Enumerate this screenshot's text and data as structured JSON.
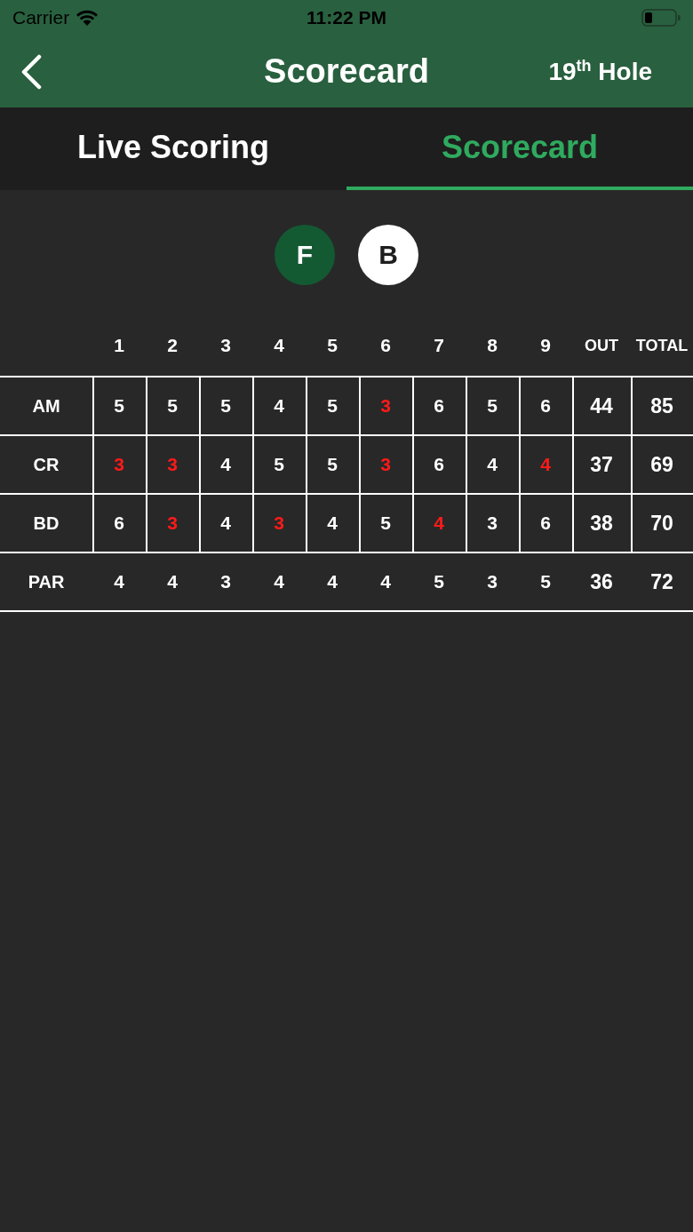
{
  "status_bar": {
    "carrier": "Carrier",
    "time": "11:22 PM"
  },
  "nav": {
    "title": "Scorecard",
    "action": "19$^{th}$ Hole"
  },
  "tabs": [
    {
      "label": "Live Scoring",
      "selected": false
    },
    {
      "label": "Scorecard",
      "selected": true
    }
  ],
  "nine_toggle": [
    {
      "label": "F",
      "selected": true
    },
    {
      "label": "B",
      "selected": false
    }
  ],
  "table": {
    "columns": [
      "1",
      "2",
      "3",
      "4",
      "5",
      "6",
      "7",
      "8",
      "9",
      "OUT",
      "TOTAL"
    ],
    "rows": [
      {
        "kind": "player",
        "name": "AM",
        "scores": [
          {
            "value": "5",
            "under_par": false
          },
          {
            "value": "5",
            "under_par": false
          },
          {
            "value": "5",
            "under_par": false
          },
          {
            "value": "4",
            "under_par": false
          },
          {
            "value": "5",
            "under_par": false
          },
          {
            "value": "3",
            "under_par": true
          },
          {
            "value": "6",
            "under_par": false
          },
          {
            "value": "5",
            "under_par": false
          },
          {
            "value": "6",
            "under_par": false
          }
        ],
        "out": "44",
        "total": "85"
      },
      {
        "kind": "player",
        "name": "CR",
        "scores": [
          {
            "value": "3",
            "under_par": true
          },
          {
            "value": "3",
            "under_par": true
          },
          {
            "value": "4",
            "under_par": false
          },
          {
            "value": "5",
            "under_par": false
          },
          {
            "value": "5",
            "under_par": false
          },
          {
            "value": "3",
            "under_par": true
          },
          {
            "value": "6",
            "under_par": false
          },
          {
            "value": "4",
            "under_par": false
          },
          {
            "value": "4",
            "under_par": true
          }
        ],
        "out": "37",
        "total": "69"
      },
      {
        "kind": "player",
        "name": "BD",
        "scores": [
          {
            "value": "6",
            "under_par": false
          },
          {
            "value": "3",
            "under_par": true
          },
          {
            "value": "4",
            "under_par": false
          },
          {
            "value": "3",
            "under_par": true
          },
          {
            "value": "4",
            "under_par": false
          },
          {
            "value": "5",
            "under_par": false
          },
          {
            "value": "4",
            "under_par": true
          },
          {
            "value": "3",
            "under_par": false
          },
          {
            "value": "6",
            "under_par": false
          }
        ],
        "out": "38",
        "total": "70"
      },
      {
        "kind": "par",
        "name": "PAR",
        "scores": [
          {
            "value": "4",
            "under_par": false
          },
          {
            "value": "4",
            "under_par": false
          },
          {
            "value": "3",
            "under_par": false
          },
          {
            "value": "4",
            "under_par": false
          },
          {
            "value": "4",
            "under_par": false
          },
          {
            "value": "4",
            "under_par": false
          },
          {
            "value": "5",
            "under_par": false
          },
          {
            "value": "3",
            "under_par": false
          },
          {
            "value": "5",
            "under_par": false
          }
        ],
        "out": "36",
        "total": "72"
      }
    ]
  }
}
